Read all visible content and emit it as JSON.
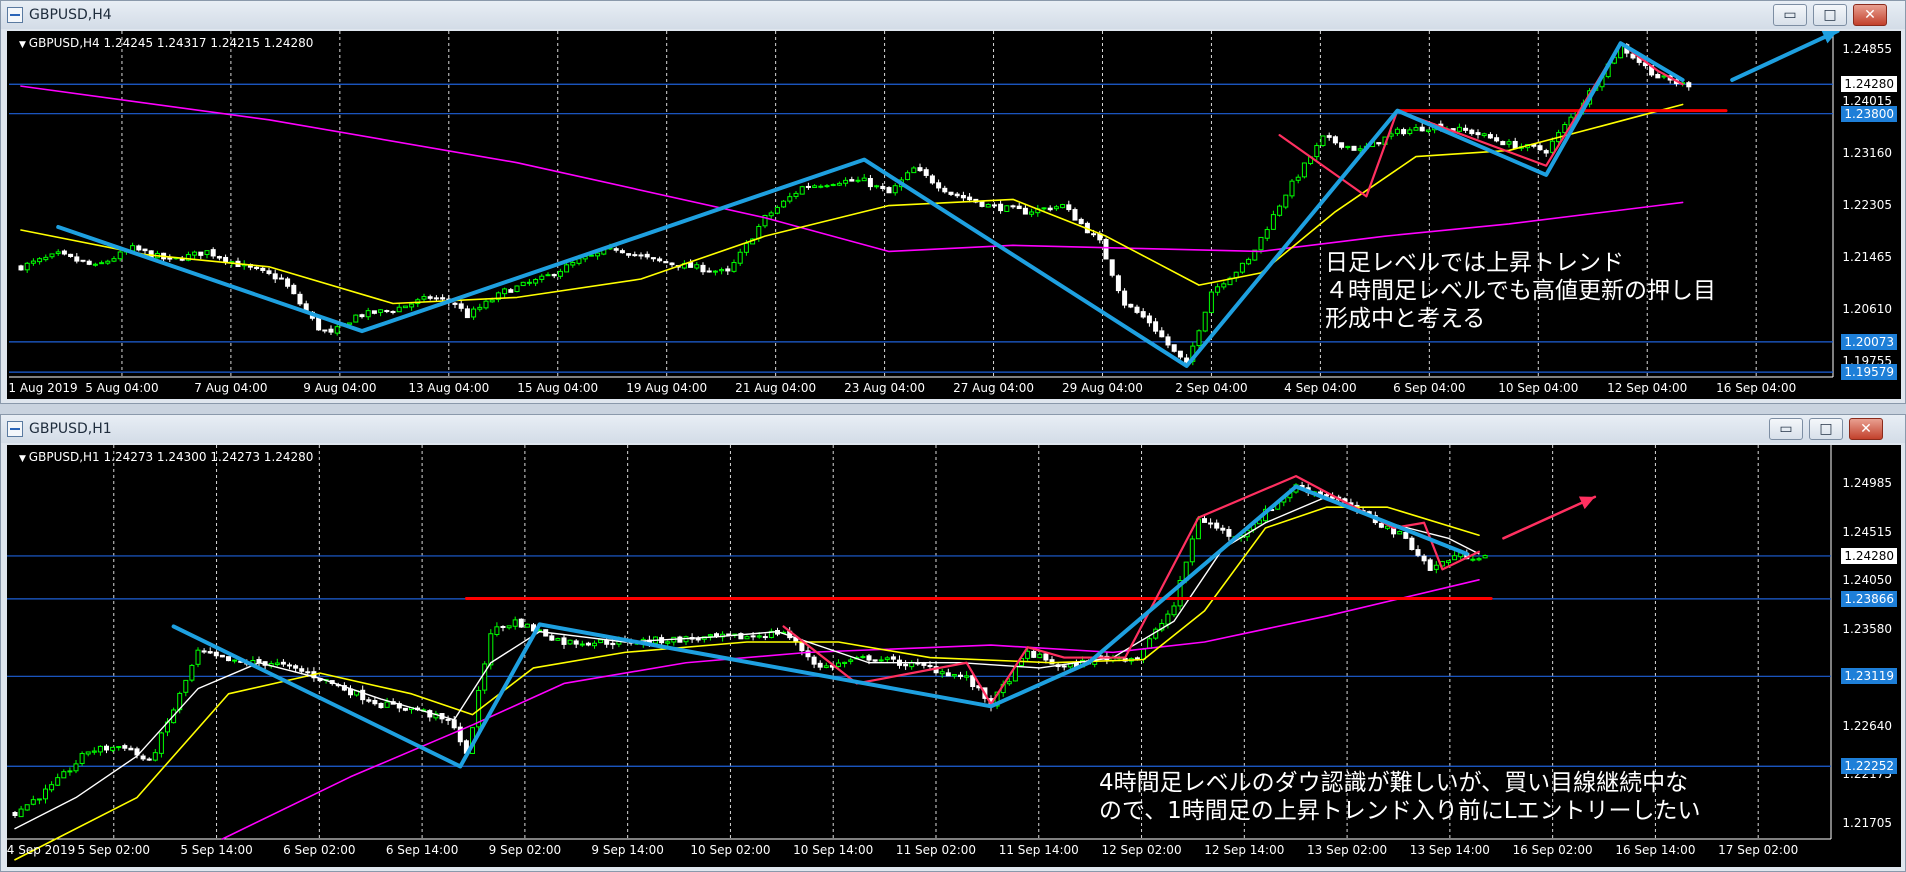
{
  "windows": [
    {
      "title": "GBPUSD,H4",
      "info": "GBPUSD,H4  1.24245 1.24317 1.24215 1.24280",
      "note": [
        "日足レベルでは上昇トレンド",
        "４時間足レベルでも高値更新の押し目",
        "形成中と考える"
      ]
    },
    {
      "title": "GBPUSD,H1",
      "info": "GBPUSD,H1  1.24273 1.24300 1.24273 1.24280",
      "note": [
        "4時間足レベルのダウ認識が難しいが、買い目線継続中な",
        "ので、1時間足の上昇トレンド入り前にLエントリーしたい"
      ]
    }
  ],
  "controls": {
    "minimize": "▭",
    "maximize": "□",
    "close": "✕"
  },
  "colors": {
    "candle_bull": "#00ff00",
    "candle_bear": "#ffffff",
    "ma_fast": "#ffff00",
    "ma_slow": "#ff00ff",
    "ma_h1_white": "#ffffff",
    "trend_blue": "#1ea0e0",
    "trend_pink": "#ff3060",
    "support_red": "#ff0000",
    "hline_blue": "#1e60d8",
    "grid": "#ffffff"
  },
  "chart_data": [
    {
      "type": "candlestick",
      "symbol": "GBPUSD",
      "timeframe": "H4",
      "x_ticks": [
        "1 Aug 2019",
        "5 Aug 04:00",
        "7 Aug 04:00",
        "9 Aug 04:00",
        "13 Aug 04:00",
        "15 Aug 04:00",
        "19 Aug 04:00",
        "21 Aug 04:00",
        "23 Aug 04:00",
        "27 Aug 04:00",
        "29 Aug 04:00",
        "2 Sep 04:00",
        "4 Sep 04:00",
        "6 Sep 04:00",
        "10 Sep 04:00",
        "12 Sep 04:00",
        "16 Sep 04:00"
      ],
      "y_ticks": [
        1.24855,
        1.24015,
        1.2316,
        1.22305,
        1.21465,
        1.2061,
        1.19755
      ],
      "ylim": [
        1.195,
        1.2515
      ],
      "price_labels": [
        {
          "value": 1.2428,
          "text": "1.24280",
          "style": "box"
        },
        {
          "value": 1.238,
          "text": "1.23800",
          "style": "blue"
        },
        {
          "value": 1.20073,
          "text": "1.20073",
          "style": "blue"
        },
        {
          "value": 1.19579,
          "text": "1.19579",
          "style": "blue"
        }
      ],
      "hlines": [
        1.2428,
        1.238,
        1.20073,
        1.19579
      ],
      "close_path": [
        [
          0,
          1.213
        ],
        [
          6,
          1.215
        ],
        [
          12,
          1.213
        ],
        [
          18,
          1.216
        ],
        [
          24,
          1.214
        ],
        [
          30,
          1.2155
        ],
        [
          36,
          1.213
        ],
        [
          42,
          1.211
        ],
        [
          48,
          1.203
        ],
        [
          50,
          1.202
        ],
        [
          54,
          1.205
        ],
        [
          60,
          1.206
        ],
        [
          66,
          1.208
        ],
        [
          70,
          1.207
        ],
        [
          72,
          1.205
        ],
        [
          78,
          1.209
        ],
        [
          84,
          1.211
        ],
        [
          90,
          1.214
        ],
        [
          96,
          1.216
        ],
        [
          102,
          1.214
        ],
        [
          108,
          1.213
        ],
        [
          114,
          1.212
        ],
        [
          120,
          1.221
        ],
        [
          126,
          1.226
        ],
        [
          132,
          1.227
        ],
        [
          136,
          1.227
        ],
        [
          140,
          1.225
        ],
        [
          144,
          1.229
        ],
        [
          150,
          1.225
        ],
        [
          156,
          1.223
        ],
        [
          162,
          1.222
        ],
        [
          168,
          1.223
        ],
        [
          174,
          1.217
        ],
        [
          178,
          1.207
        ],
        [
          182,
          1.204
        ],
        [
          186,
          1.199
        ],
        [
          188,
          1.197
        ],
        [
          192,
          1.209
        ],
        [
          198,
          1.214
        ],
        [
          204,
          1.225
        ],
        [
          210,
          1.234
        ],
        [
          216,
          1.232
        ],
        [
          222,
          1.235
        ],
        [
          228,
          1.236
        ],
        [
          234,
          1.235
        ],
        [
          240,
          1.233
        ],
        [
          246,
          1.232
        ],
        [
          252,
          1.24
        ],
        [
          258,
          1.249
        ],
        [
          264,
          1.244
        ],
        [
          268,
          1.2428
        ]
      ],
      "n_bars": 270,
      "ma_yellow": [
        [
          0,
          1.219
        ],
        [
          20,
          1.215
        ],
        [
          40,
          1.213
        ],
        [
          60,
          1.207
        ],
        [
          80,
          1.208
        ],
        [
          100,
          1.211
        ],
        [
          120,
          1.218
        ],
        [
          140,
          1.223
        ],
        [
          160,
          1.224
        ],
        [
          175,
          1.218
        ],
        [
          190,
          1.21
        ],
        [
          200,
          1.212
        ],
        [
          212,
          1.222
        ],
        [
          225,
          1.231
        ],
        [
          240,
          1.232
        ],
        [
          255,
          1.236
        ],
        [
          268,
          1.2395
        ]
      ],
      "ma_magenta": [
        [
          0,
          1.2425
        ],
        [
          40,
          1.237
        ],
        [
          80,
          1.23
        ],
        [
          120,
          1.221
        ],
        [
          140,
          1.2155
        ],
        [
          160,
          1.2165
        ],
        [
          180,
          1.216
        ],
        [
          200,
          1.2155
        ],
        [
          220,
          1.218
        ],
        [
          240,
          1.22
        ],
        [
          268,
          1.2235
        ]
      ],
      "trend_blue": [
        [
          6,
          1.2195
        ],
        [
          55,
          1.2025
        ],
        [
          136,
          1.2305
        ],
        [
          188,
          1.1968
        ],
        [
          222,
          1.2385
        ],
        [
          246,
          1.228
        ],
        [
          258,
          1.2495
        ],
        [
          268,
          1.2435
        ]
      ],
      "trend_pink": [
        [
          203,
          1.2345
        ],
        [
          217,
          1.2245
        ],
        [
          222,
          1.2385
        ],
        [
          246,
          1.2295
        ],
        [
          258,
          1.2495
        ],
        [
          264,
          1.245
        ],
        [
          268,
          1.2428
        ]
      ],
      "support_red": [
        [
          222,
          1.2385
        ],
        [
          275,
          1.2385
        ]
      ],
      "arrow_blue": [
        [
          276,
          1.2435
        ],
        [
          293,
          1.2515
        ]
      ]
    },
    {
      "type": "candlestick",
      "symbol": "GBPUSD",
      "timeframe": "H1",
      "x_ticks": [
        "4 Sep 2019",
        "5 Sep 02:00",
        "5 Sep 14:00",
        "6 Sep 02:00",
        "6 Sep 14:00",
        "9 Sep 02:00",
        "9 Sep 14:00",
        "10 Sep 02:00",
        "10 Sep 14:00",
        "11 Sep 02:00",
        "11 Sep 14:00",
        "12 Sep 02:00",
        "12 Sep 14:00",
        "13 Sep 02:00",
        "13 Sep 14:00",
        "16 Sep 02:00",
        "16 Sep 14:00",
        "17 Sep 02:00"
      ],
      "y_ticks": [
        1.24985,
        1.24515,
        1.2405,
        1.2358,
        1.23115,
        1.2264,
        1.22175,
        1.21705
      ],
      "ylim": [
        1.2155,
        1.2535
      ],
      "price_labels": [
        {
          "value": 1.2428,
          "text": "1.24280",
          "style": "box"
        },
        {
          "value": 1.23866,
          "text": "1.23866",
          "style": "blue"
        },
        {
          "value": 1.23119,
          "text": "1.23119",
          "style": "blue"
        },
        {
          "value": 1.22252,
          "text": "1.22252",
          "style": "blue"
        }
      ],
      "hlines": [
        1.2428,
        1.23866,
        1.23119,
        1.22252
      ],
      "close_path": [
        [
          0,
          1.218
        ],
        [
          6,
          1.2205
        ],
        [
          12,
          1.224
        ],
        [
          18,
          1.2245
        ],
        [
          22,
          1.2228
        ],
        [
          26,
          1.228
        ],
        [
          30,
          1.2335
        ],
        [
          36,
          1.2325
        ],
        [
          42,
          1.2325
        ],
        [
          48,
          1.2315
        ],
        [
          54,
          1.23
        ],
        [
          60,
          1.2285
        ],
        [
          66,
          1.228
        ],
        [
          72,
          1.2265
        ],
        [
          74,
          1.2235
        ],
        [
          78,
          1.2355
        ],
        [
          82,
          1.2365
        ],
        [
          90,
          1.2345
        ],
        [
          100,
          1.2345
        ],
        [
          110,
          1.2348
        ],
        [
          120,
          1.235
        ],
        [
          126,
          1.2355
        ],
        [
          132,
          1.232
        ],
        [
          140,
          1.233
        ],
        [
          150,
          1.232
        ],
        [
          156,
          1.231
        ],
        [
          160,
          1.2285
        ],
        [
          166,
          1.2335
        ],
        [
          172,
          1.232
        ],
        [
          178,
          1.233
        ],
        [
          184,
          1.233
        ],
        [
          190,
          1.238
        ],
        [
          194,
          1.2465
        ],
        [
          200,
          1.2445
        ],
        [
          206,
          1.2475
        ],
        [
          210,
          1.2495
        ],
        [
          216,
          1.2485
        ],
        [
          222,
          1.2465
        ],
        [
          228,
          1.2445
        ],
        [
          232,
          1.2415
        ],
        [
          236,
          1.2428
        ],
        [
          240,
          1.2428
        ]
      ],
      "n_bars": 242,
      "ma_white": [
        [
          0,
          1.2165
        ],
        [
          10,
          1.2195
        ],
        [
          20,
          1.2235
        ],
        [
          30,
          1.23
        ],
        [
          40,
          1.2325
        ],
        [
          50,
          1.231
        ],
        [
          60,
          1.229
        ],
        [
          72,
          1.227
        ],
        [
          78,
          1.2325
        ],
        [
          86,
          1.2355
        ],
        [
          100,
          1.2345
        ],
        [
          115,
          1.235
        ],
        [
          125,
          1.2355
        ],
        [
          140,
          1.2325
        ],
        [
          155,
          1.2325
        ],
        [
          168,
          1.232
        ],
        [
          180,
          1.233
        ],
        [
          190,
          1.2365
        ],
        [
          198,
          1.2435
        ],
        [
          205,
          1.246
        ],
        [
          215,
          1.2485
        ],
        [
          225,
          1.246
        ],
        [
          235,
          1.2445
        ],
        [
          240,
          1.243
        ]
      ],
      "ma_yellow": [
        [
          0,
          1.2135
        ],
        [
          20,
          1.2195
        ],
        [
          35,
          1.2295
        ],
        [
          50,
          1.2315
        ],
        [
          65,
          1.2295
        ],
        [
          75,
          1.2275
        ],
        [
          85,
          1.232
        ],
        [
          100,
          1.2335
        ],
        [
          120,
          1.2345
        ],
        [
          135,
          1.2345
        ],
        [
          150,
          1.233
        ],
        [
          170,
          1.2325
        ],
        [
          185,
          1.2328
        ],
        [
          195,
          1.2375
        ],
        [
          205,
          1.2455
        ],
        [
          215,
          1.2475
        ],
        [
          225,
          1.2475
        ],
        [
          240,
          1.2448
        ]
      ],
      "ma_magenta": [
        [
          34,
          1.2155
        ],
        [
          55,
          1.2215
        ],
        [
          75,
          1.2265
        ],
        [
          90,
          1.2305
        ],
        [
          110,
          1.2325
        ],
        [
          130,
          1.2335
        ],
        [
          160,
          1.2342
        ],
        [
          180,
          1.2335
        ],
        [
          195,
          1.2345
        ],
        [
          215,
          1.237
        ],
        [
          240,
          1.2405
        ]
      ],
      "trend_blue": [
        [
          26,
          1.236
        ],
        [
          73,
          1.2225
        ],
        [
          86,
          1.2362
        ],
        [
          160,
          1.2283
        ],
        [
          176,
          1.2325
        ],
        [
          210,
          1.2495
        ],
        [
          238,
          1.243
        ]
      ],
      "trend_pink": [
        [
          126,
          1.236
        ],
        [
          138,
          1.2305
        ],
        [
          156,
          1.2325
        ],
        [
          160,
          1.2285
        ],
        [
          166,
          1.234
        ],
        [
          172,
          1.233
        ],
        [
          182,
          1.233
        ],
        [
          194,
          1.2465
        ],
        [
          210,
          1.2505
        ],
        [
          226,
          1.2455
        ],
        [
          231,
          1.246
        ],
        [
          234,
          1.2415
        ],
        [
          240,
          1.2432
        ]
      ],
      "support_red": [
        [
          74,
          1.2387
        ],
        [
          242,
          1.2387
        ]
      ],
      "arrow_pink": [
        [
          244,
          1.2445
        ],
        [
          259,
          1.2485
        ]
      ]
    }
  ]
}
